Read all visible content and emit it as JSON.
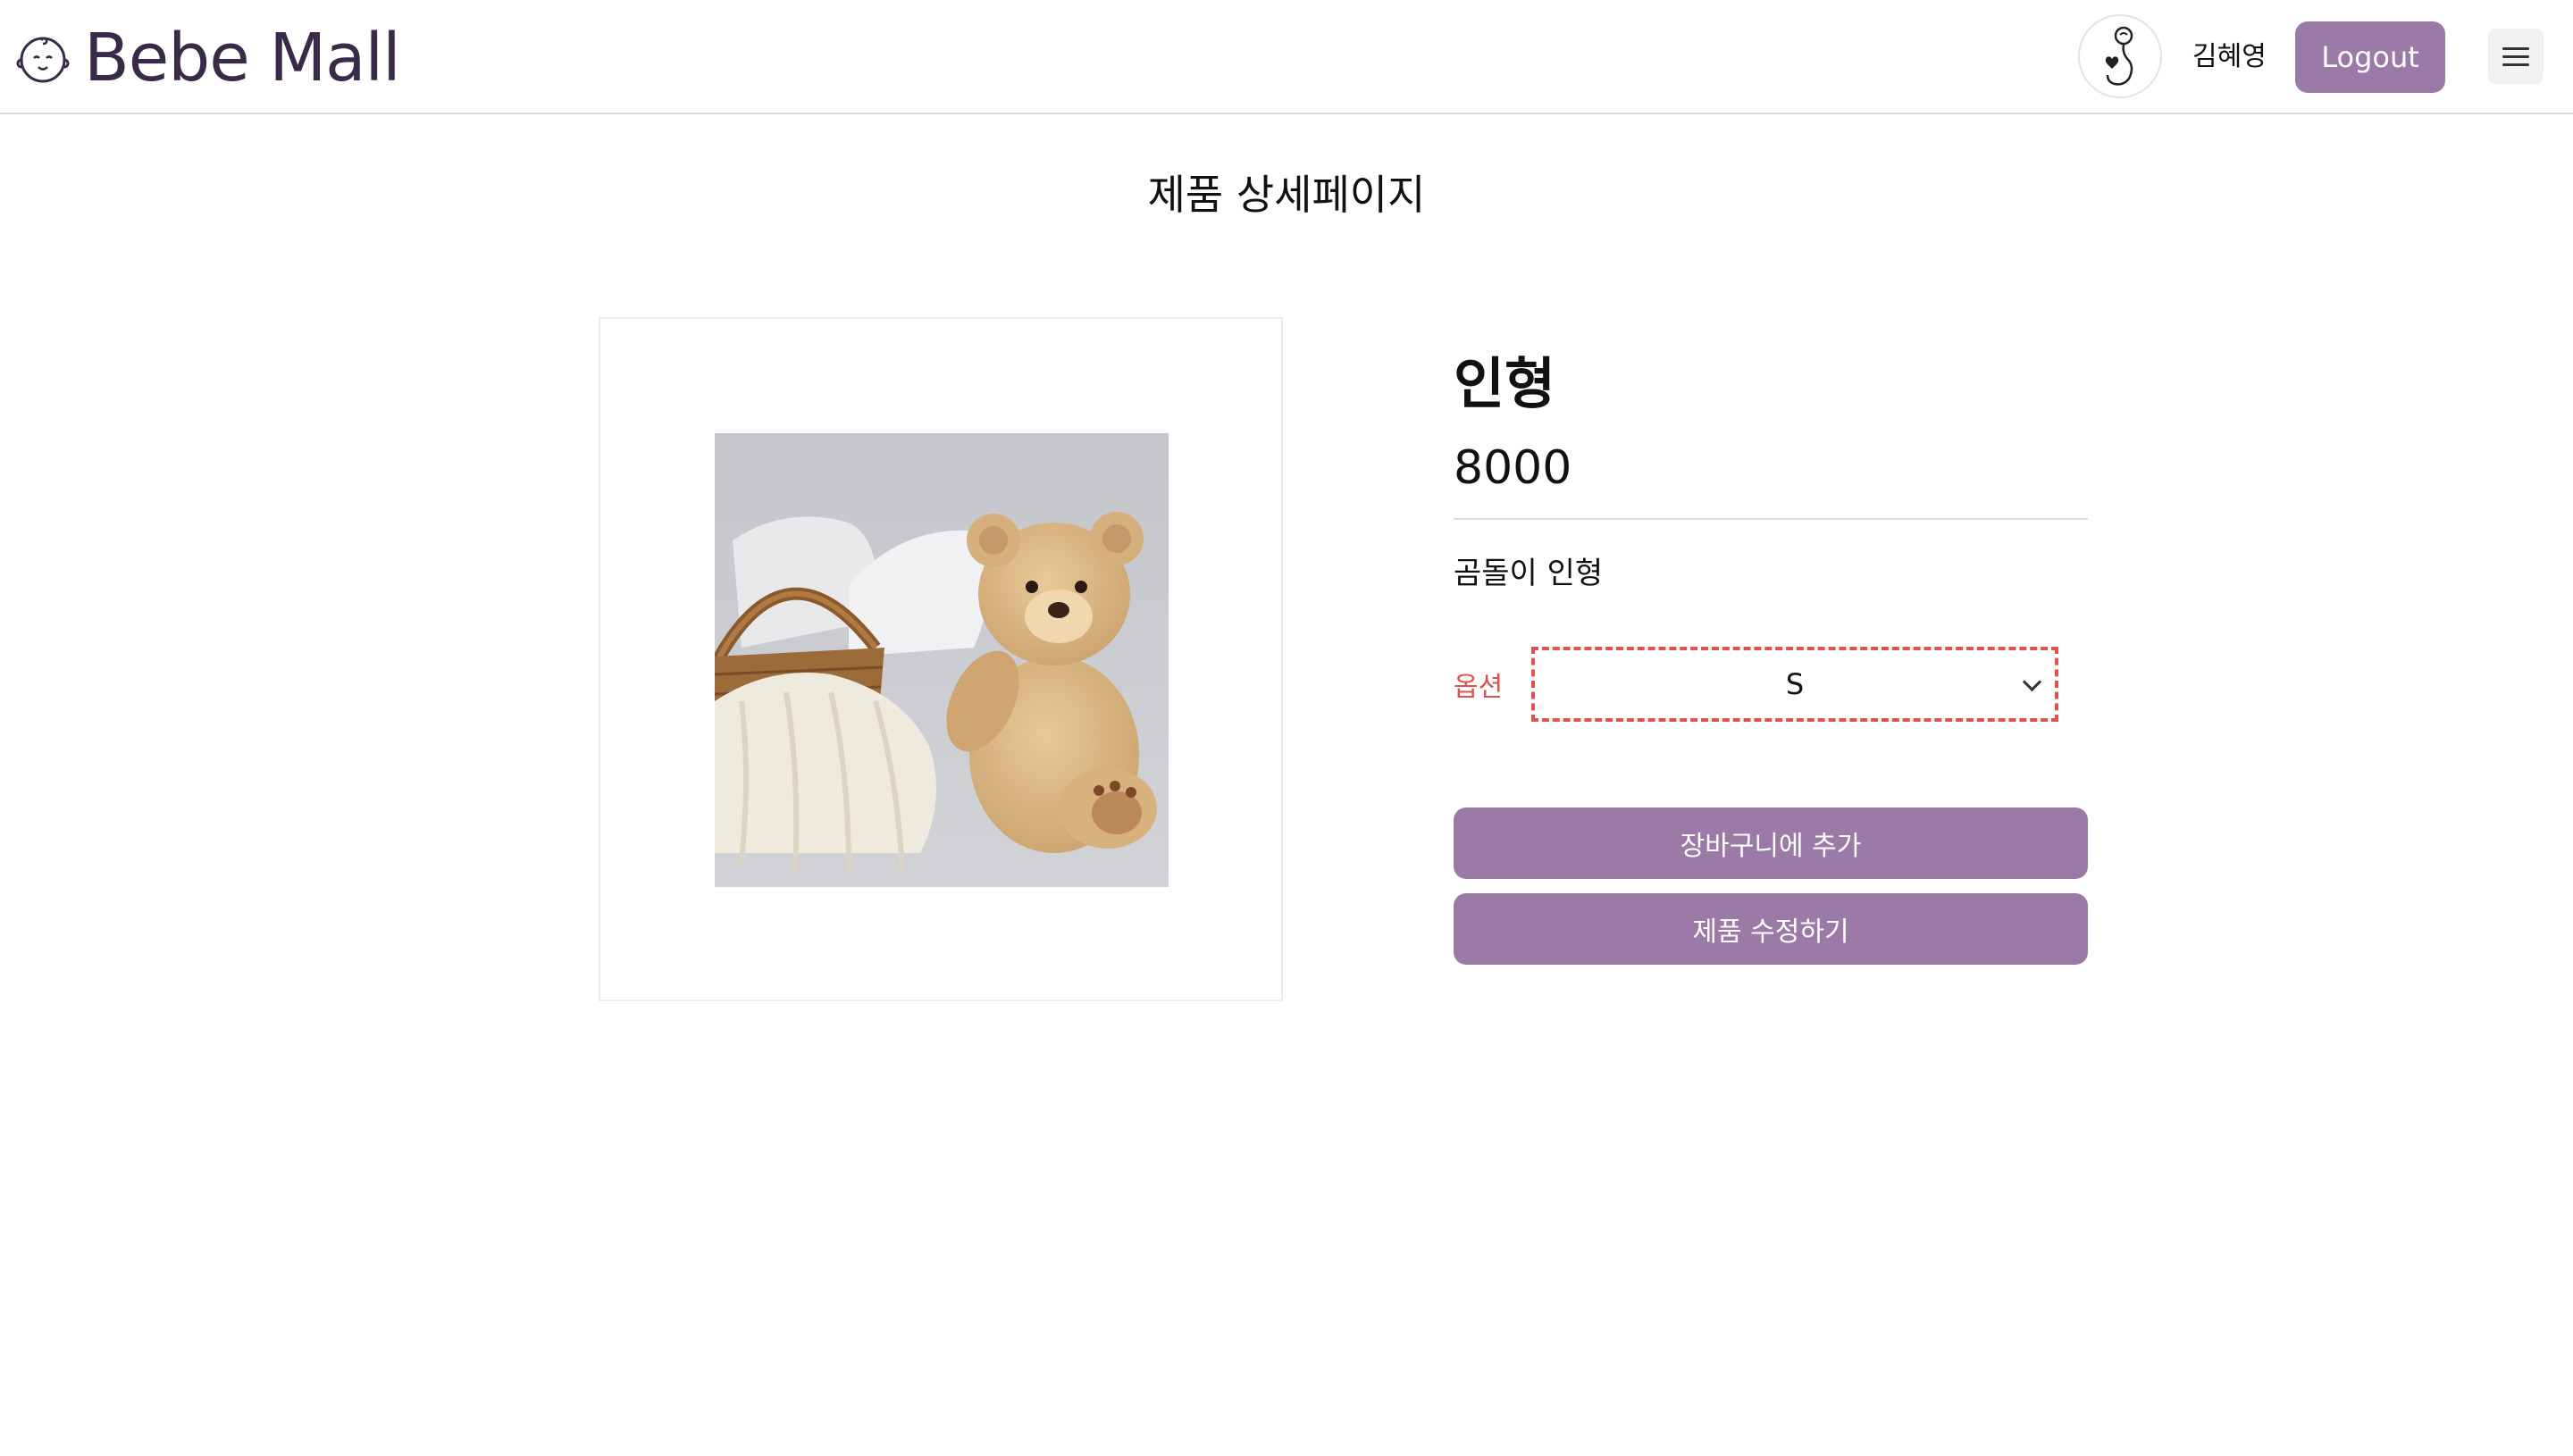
{
  "header": {
    "brand": "Bebe Mall",
    "user_name": "김혜영",
    "logout_label": "Logout",
    "icons": {
      "brand": "baby-face-icon",
      "avatar": "baby-avatar-icon",
      "menu": "hamburger-menu-icon"
    }
  },
  "page": {
    "title": "제품 상세페이지"
  },
  "product": {
    "name": "인형",
    "price": "8000",
    "description": "곰돌이 인형",
    "option_label": "옵션",
    "option_selected": "S",
    "image_description": "teddy-bear-with-knit-blanket-and-basket"
  },
  "actions": {
    "add_to_cart": "장바구니에 추가",
    "edit_product": "제품 수정하기"
  },
  "colors": {
    "accent": "#9b7aa8",
    "brand_text": "#3a2a4a",
    "option_label": "#d9534f",
    "select_border": "#e05252"
  }
}
